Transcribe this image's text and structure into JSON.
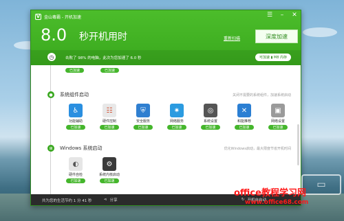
{
  "app": {
    "title": "金山毒霸 - 开机加速",
    "logo_glyph": "V",
    "window_controls": [
      "☰",
      "–",
      "✕"
    ]
  },
  "header": {
    "time_number": "8.0",
    "time_label": "秒开机用时",
    "rescan_link": "重新扫描",
    "deep_button": "深度加速",
    "info_text": "击败了 98% 的电脑，此次为您加速了 6.0 秒",
    "shortcut_pill": "可加速  ▮ M8 内存"
  },
  "top_pills": [
    "已加速",
    "已加速"
  ],
  "sections": [
    {
      "title": "系统组件启动",
      "note": "关闭不需要的系统组件，加速系统启动",
      "items": [
        {
          "label": "功能辅助",
          "status": "已加速",
          "icon": "accessibility-icon",
          "color": "#2a8fe0",
          "glyph": "♿"
        },
        {
          "label": "硬件控制",
          "status": "已加速",
          "icon": "hardware-control-icon",
          "color": "#e8e8e8",
          "glyph": "☷"
        },
        {
          "label": "安全服务",
          "status": "已加速",
          "icon": "security-service-icon",
          "color": "#2f7fd0",
          "glyph": "⛨"
        },
        {
          "label": "网络服务",
          "status": "已加速",
          "icon": "network-service-icon",
          "color": "#2b9be0",
          "glyph": "✷"
        },
        {
          "label": "系统设置",
          "status": "已加速",
          "icon": "system-settings-icon",
          "color": "#555555",
          "glyph": "◎"
        },
        {
          "label": "和能推荐",
          "status": "已加速",
          "icon": "tools-icon",
          "color": "#2b7fd3",
          "glyph": "✕"
        },
        {
          "label": "网络设置",
          "status": "已加速",
          "icon": "network-settings-icon",
          "color": "#9a9a9a",
          "glyph": "▣"
        }
      ]
    },
    {
      "title": "Windows 系统启动",
      "note": "优化Windows启动，最大限度节省开机时间",
      "items": [
        {
          "label": "硬件自检",
          "status": "已加速",
          "icon": "hardware-check-icon",
          "color": "#e6e6e6",
          "glyph": "◐"
        },
        {
          "label": "系统内核启动",
          "status": "已加速",
          "icon": "kernel-gear-icon",
          "color": "#3a3a3a",
          "glyph": "⚙"
        }
      ]
    }
  ],
  "footer": {
    "saved_text": "共为您的生活节约 1 分 41 秒",
    "share": "分享",
    "right_text": "开机自启动"
  },
  "watermark": {
    "line1": "office教程学习网",
    "line2": "www.office68.com"
  }
}
